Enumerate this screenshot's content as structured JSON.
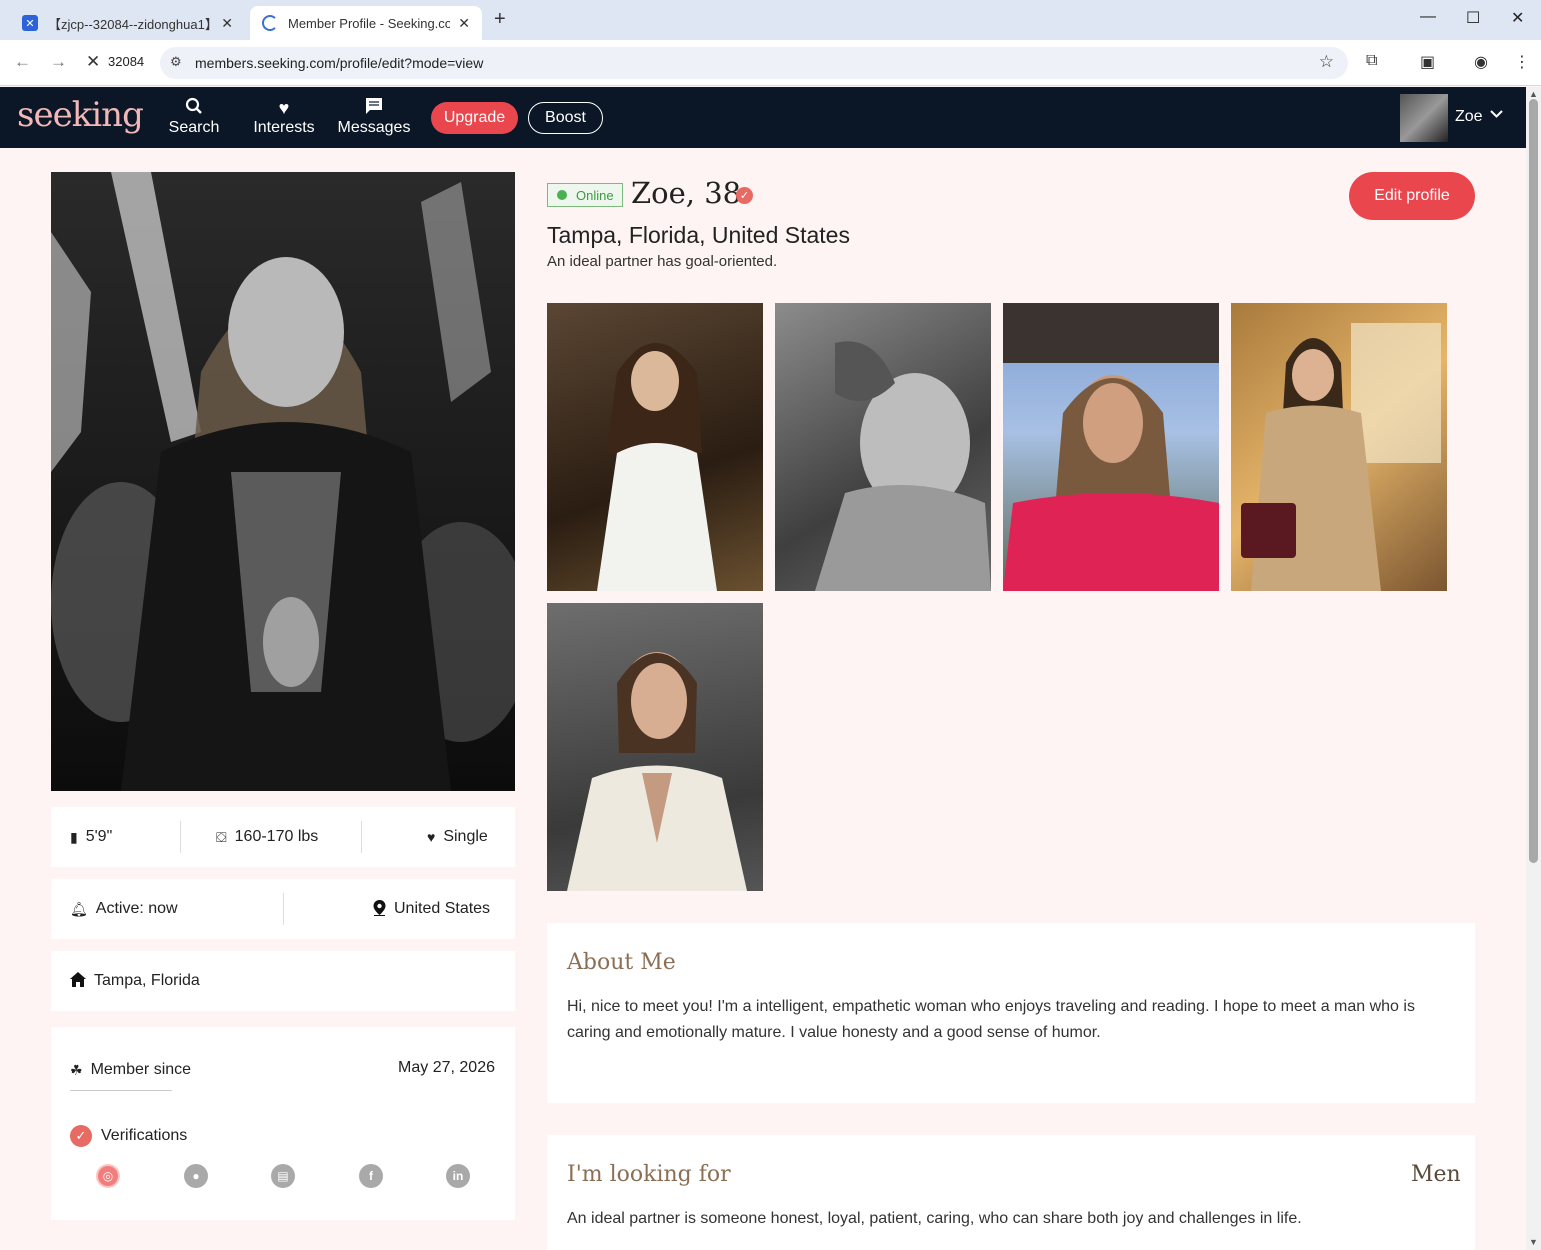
{
  "browser": {
    "tabs": [
      {
        "title": "【zjcp--32084--zidonghua1】"
      },
      {
        "title": "Member Profile - Seeking.com"
      }
    ],
    "site_chip": "32084",
    "url": "members.seeking.com/profile/edit?mode=view"
  },
  "header": {
    "logo": "seeking",
    "nav": [
      {
        "label": "Search",
        "icon": "search-icon"
      },
      {
        "label": "Interests",
        "icon": "heart-icon"
      },
      {
        "label": "Messages",
        "icon": "chat-icon"
      }
    ],
    "upgrade_label": "Upgrade",
    "boost_label": "Boost",
    "user_name": "Zoe"
  },
  "profile": {
    "status": "Online",
    "name_age": "Zoe, 38",
    "location": "Tampa, Florida, United States",
    "tagline": "An ideal partner has goal-oriented.",
    "edit_label": "Edit profile"
  },
  "stats": {
    "height": "5'9\"",
    "weight": "160-170 lbs",
    "relationship": "Single",
    "active": "Active: now",
    "country": "United States",
    "hometown": "Tampa, Florida",
    "member_since_label": "Member since",
    "member_since_date": "May 27, 2026",
    "verifications_label": "Verifications"
  },
  "about": {
    "title": "About Me",
    "text": "Hi, nice to meet you! I'm a intelligent, empathetic woman who enjoys traveling and reading. I hope to meet a man who is caring and emotionally mature. I value honesty and a good sense of humor."
  },
  "looking_for": {
    "title": "I'm looking for",
    "target": "Men",
    "text": "An ideal partner is someone honest, loyal, patient, caring, who can share both joy and challenges in life."
  },
  "colors": {
    "accent": "#e9474d",
    "header_bg": "#0b1726",
    "logo": "#f2b7b7",
    "section_title": "#8b6f55",
    "page_bg": "#fdf4f3"
  }
}
